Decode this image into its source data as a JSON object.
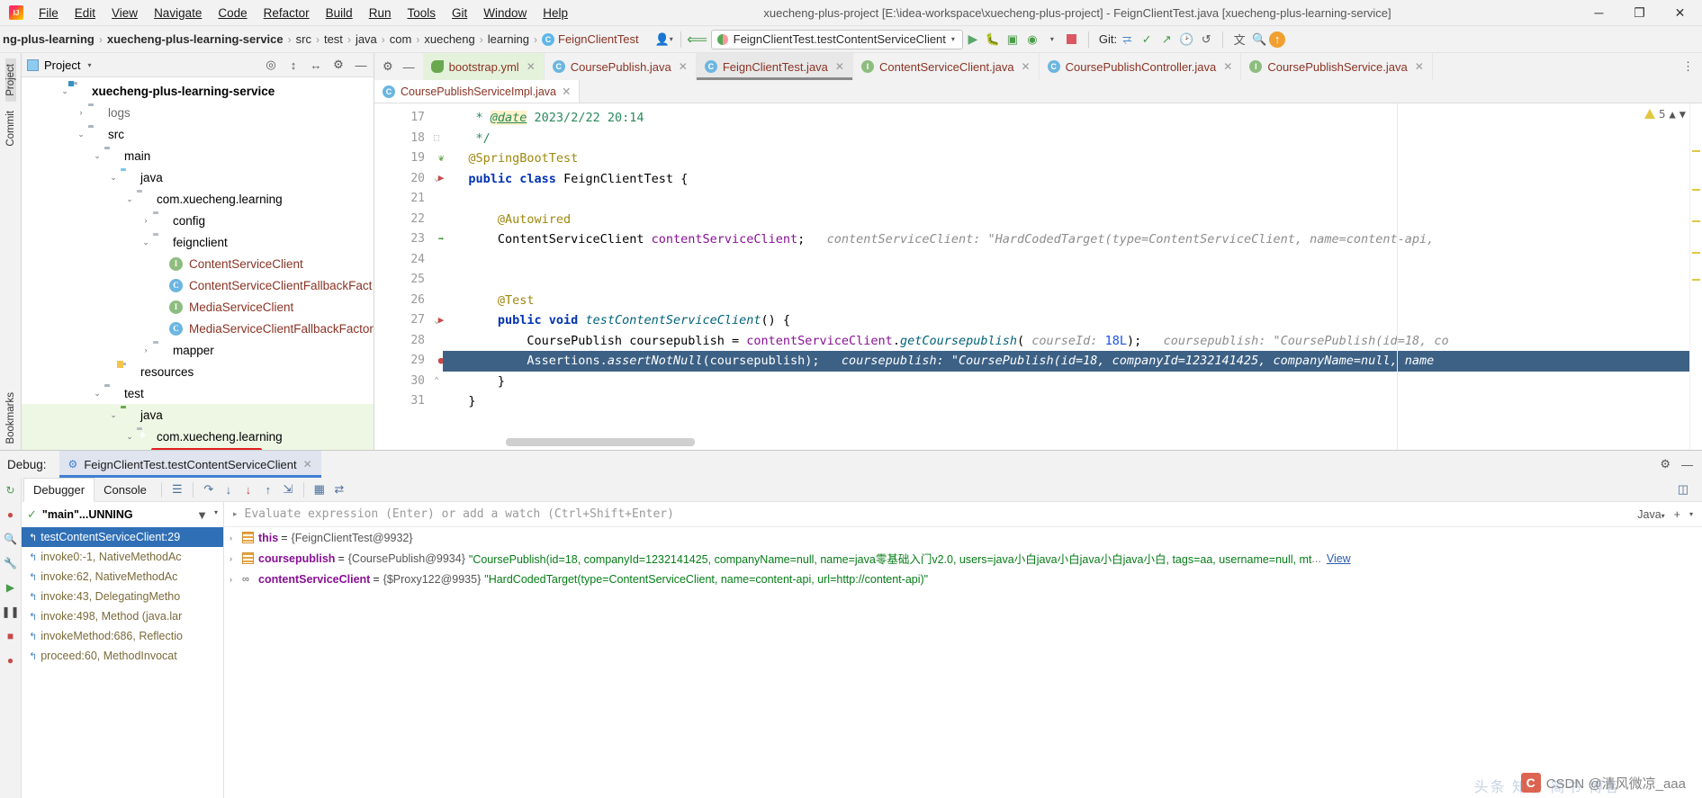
{
  "titlebar": {
    "menu": [
      "File",
      "Edit",
      "View",
      "Navigate",
      "Code",
      "Refactor",
      "Build",
      "Run",
      "Tools",
      "Git",
      "Window",
      "Help"
    ],
    "window_title": "xuecheng-plus-project [E:\\idea-workspace\\xuecheng-plus-project] - FeignClientTest.java [xuecheng-plus-learning-service]",
    "minimize": "─",
    "maximize": "❐",
    "close": "✕"
  },
  "navbar": {
    "crumbs": [
      "ng-plus-learning",
      "xuecheng-plus-learning-service",
      "src",
      "test",
      "java",
      "com",
      "xuecheng",
      "learning",
      "FeignClientTest"
    ],
    "separator": "›",
    "run_config": "FeignClientTest.testContentServiceClient",
    "git_label": "Git:",
    "caret": "▾"
  },
  "project_panel": {
    "title": "Project",
    "caret": "▾",
    "tree": [
      {
        "label": "xuecheng-plus-learning-service",
        "indent": 2,
        "arrow": "⌄",
        "icon": "module-folder",
        "style": "bold"
      },
      {
        "label": "logs",
        "indent": 3,
        "arrow": "›",
        "icon": "folder",
        "style": "grey"
      },
      {
        "label": "src",
        "indent": 3,
        "arrow": "⌄",
        "icon": "folder",
        "style": "plain"
      },
      {
        "label": "main",
        "indent": 4,
        "arrow": "⌄",
        "icon": "folder",
        "style": "plain"
      },
      {
        "label": "java",
        "indent": 5,
        "arrow": "⌄",
        "icon": "source-folder",
        "style": "plain"
      },
      {
        "label": "com.xuecheng.learning",
        "indent": 6,
        "arrow": "⌄",
        "icon": "package",
        "style": "plain"
      },
      {
        "label": "config",
        "indent": 7,
        "arrow": "›",
        "icon": "package",
        "style": "plain"
      },
      {
        "label": "feignclient",
        "indent": 7,
        "arrow": "⌄",
        "icon": "package",
        "style": "plain"
      },
      {
        "label": "ContentServiceClient",
        "indent": 8,
        "arrow": "",
        "icon": "interface",
        "style": "rust"
      },
      {
        "label": "ContentServiceClientFallbackFact",
        "indent": 8,
        "arrow": "",
        "icon": "class",
        "style": "rust"
      },
      {
        "label": "MediaServiceClient",
        "indent": 8,
        "arrow": "",
        "icon": "interface",
        "style": "rust"
      },
      {
        "label": "MediaServiceClientFallbackFactor",
        "indent": 8,
        "arrow": "",
        "icon": "class",
        "style": "rust"
      },
      {
        "label": "mapper",
        "indent": 7,
        "arrow": "›",
        "icon": "package",
        "style": "plain"
      },
      {
        "label": "resources",
        "indent": 5,
        "arrow": "",
        "icon": "resource-folder",
        "style": "plain"
      },
      {
        "label": "test",
        "indent": 4,
        "arrow": "⌄",
        "icon": "folder",
        "style": "plain"
      },
      {
        "label": "java",
        "indent": 5,
        "arrow": "⌄",
        "icon": "test-source-folder",
        "style": "plain",
        "highlight": true
      },
      {
        "label": "com.xuecheng.learning",
        "indent": 6,
        "arrow": "⌄",
        "icon": "package",
        "style": "plain",
        "highlight": true
      },
      {
        "label": "FeignClientTest",
        "indent": 7,
        "arrow": "",
        "icon": "test-class",
        "style": "rust",
        "highlight": true,
        "boxed": true
      },
      {
        "label": "LearningApplication",
        "indent": 7,
        "arrow": "",
        "icon": "class",
        "style": "rust",
        "highlight": true
      }
    ]
  },
  "editor": {
    "tabs_row1": [
      {
        "label": "bootstrap.yml",
        "icon": "yaml",
        "state": "green"
      },
      {
        "label": "CoursePublish.java",
        "icon": "class",
        "state": "normal"
      },
      {
        "label": "FeignClientTest.java",
        "icon": "test-class",
        "state": "active"
      },
      {
        "label": "ContentServiceClient.java",
        "icon": "interface",
        "state": "normal"
      },
      {
        "label": "CoursePublishController.java",
        "icon": "class",
        "state": "normal"
      },
      {
        "label": "CoursePublishService.java",
        "icon": "interface",
        "state": "normal"
      }
    ],
    "tabs_row2": [
      {
        "label": "CoursePublishServiceImpl.java",
        "icon": "class"
      }
    ],
    "close_glyph": "✕",
    "warning_count": "5",
    "line_numbers": [
      "17",
      "18",
      "19",
      "20",
      "21",
      "22",
      "23",
      "24",
      "25",
      "26",
      "27",
      "28",
      "29",
      "30",
      "31"
    ],
    "lines": [
      {
        "n": "17",
        "segments": [
          {
            "t": "    * ",
            "c": "doc"
          },
          {
            "t": "@date",
            "c": "docTag"
          },
          {
            "t": " 2023/2/22 20:14",
            "c": "doc"
          }
        ]
      },
      {
        "n": "18",
        "segments": [
          {
            "t": "    */",
            "c": "doc"
          }
        ]
      },
      {
        "n": "19",
        "segments": [
          {
            "t": "   @SpringBootTest",
            "c": "ann"
          }
        ]
      },
      {
        "n": "20",
        "segments": [
          {
            "t": "   ",
            "c": "typ"
          },
          {
            "t": "public class",
            "c": "kw"
          },
          {
            "t": " FeignClientTest {",
            "c": "typ"
          }
        ]
      },
      {
        "n": "21",
        "segments": []
      },
      {
        "n": "22",
        "segments": [
          {
            "t": "       @Autowired",
            "c": "ann"
          }
        ]
      },
      {
        "n": "23",
        "segments": [
          {
            "t": "       ContentServiceClient ",
            "c": "typ"
          },
          {
            "t": "contentServiceClient",
            "c": "fld"
          },
          {
            "t": ";",
            "c": "typ"
          },
          {
            "t": "   contentServiceClient: \"HardCodedTarget(type=ContentServiceClient, name=content-api,",
            "c": "hint"
          }
        ]
      },
      {
        "n": "24",
        "segments": []
      },
      {
        "n": "25",
        "segments": []
      },
      {
        "n": "26",
        "segments": [
          {
            "t": "       @Test",
            "c": "ann"
          }
        ]
      },
      {
        "n": "27",
        "segments": [
          {
            "t": "       ",
            "c": "typ"
          },
          {
            "t": "public void",
            "c": "kw"
          },
          {
            "t": " ",
            "c": "typ"
          },
          {
            "t": "testContentServiceClient",
            "c": "mth"
          },
          {
            "t": "() {",
            "c": "typ"
          }
        ]
      },
      {
        "n": "28",
        "segments": [
          {
            "t": "           CoursePublish coursepublish = ",
            "c": "typ"
          },
          {
            "t": "contentServiceClient",
            "c": "fld"
          },
          {
            "t": ".",
            "c": "typ"
          },
          {
            "t": "getCoursepublish",
            "c": "mth"
          },
          {
            "t": "( ",
            "c": "typ"
          },
          {
            "t": "courseId:",
            "c": "hint"
          },
          {
            "t": " ",
            "c": "typ"
          },
          {
            "t": "18L",
            "c": "num"
          },
          {
            "t": ");",
            "c": "typ"
          },
          {
            "t": "   coursepublish: \"CoursePublish(id=18, co",
            "c": "hint"
          }
        ]
      },
      {
        "n": "29",
        "segments": [
          {
            "t": "           Assertions.",
            "c": "typ"
          },
          {
            "t": "assertNotNull",
            "c": "mth"
          },
          {
            "t": "(coursepublish);",
            "c": "typ"
          },
          {
            "t": "   coursepublish: \"CoursePublish(id=18, companyId=1232141425, companyName=null, name",
            "c": "hint"
          }
        ],
        "selected": true
      },
      {
        "n": "30",
        "segments": [
          {
            "t": "       }",
            "c": "typ"
          }
        ]
      },
      {
        "n": "31",
        "segments": [
          {
            "t": "   }",
            "c": "typ"
          }
        ]
      }
    ]
  },
  "debug": {
    "label": "Debug:",
    "session_tab": "FeignClientTest.testContentServiceClient",
    "close_glyph": "✕",
    "tabs": [
      "Debugger",
      "Console"
    ],
    "active_tab": "Debugger",
    "thread_label": "\"main\"...UNNING",
    "evaluate_placeholder": "Evaluate expression (Enter) or add a watch (Ctrl+Shift+Enter)",
    "language_selector": "Java",
    "frames": [
      {
        "label": "testContentServiceClient:29",
        "selected": true
      },
      {
        "label": "invoke0:-1, NativeMethodAc",
        "selected": false
      },
      {
        "label": "invoke:62, NativeMethodAc",
        "selected": false
      },
      {
        "label": "invoke:43, DelegatingMetho",
        "selected": false
      },
      {
        "label": "invoke:498, Method (java.lar",
        "selected": false
      },
      {
        "label": "invokeMethod:686, Reflectio",
        "selected": false
      },
      {
        "label": "proceed:60, MethodInvocat",
        "selected": false
      }
    ],
    "variables": [
      {
        "arrow": "›",
        "icon": "field",
        "name": "this",
        "eq": "=",
        "ref": "{FeignClientTest@9932}",
        "value": "",
        "more": "",
        "link": ""
      },
      {
        "arrow": "›",
        "icon": "field",
        "name": "coursepublish",
        "eq": "=",
        "ref": "{CoursePublish@9934}",
        "value": "\"CoursePublish(id=18, companyId=1232141425, companyName=null, name=java零基础入门v2.0, users=java小白java小白java小白java小白, tags=aa, username=null, mt",
        "more": "...",
        "link": "View"
      },
      {
        "arrow": "›",
        "icon": "proxy",
        "name": "contentServiceClient",
        "eq": "=",
        "ref": "{$Proxy122@9935}",
        "value": "\"HardCodedTarget(type=ContentServiceClient, name=content-api, url=http://content-api)\"",
        "more": "",
        "link": ""
      }
    ]
  },
  "left_strip": {
    "items": [
      "Project",
      "Commit"
    ]
  },
  "bottom_left_strip": {
    "items": [
      "Bookmarks"
    ]
  },
  "watermark": {
    "text": "CSDN @清风微凉_aaa",
    "cjk": "头条 知乎 简书 博客"
  }
}
